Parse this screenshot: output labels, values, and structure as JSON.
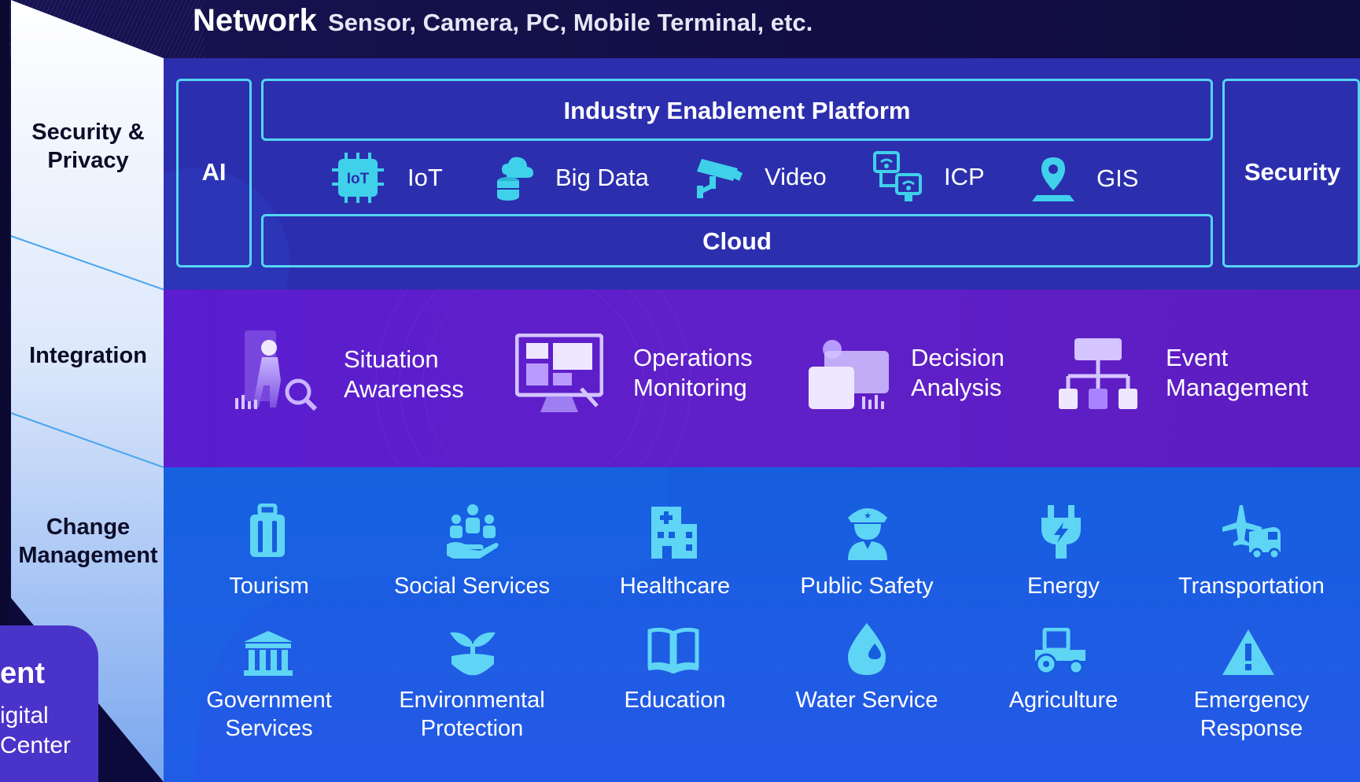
{
  "header": {
    "title": "Network",
    "subtitle": "Sensor, Camera, PC, Mobile Terminal, etc."
  },
  "left_labels": [
    "Security & Privacy",
    "Integration",
    "Change Management"
  ],
  "bottom_left": {
    "title": "ent",
    "line1": "igital",
    "line2": "Center"
  },
  "platform": {
    "ai": "AI",
    "title": "Industry Enablement Platform",
    "cloud": "Cloud",
    "security": "Security",
    "items": [
      {
        "label": "IoT",
        "icon": "iot-chip-icon",
        "icon_text": "IoT"
      },
      {
        "label": "Big Data",
        "icon": "cloud-database-icon"
      },
      {
        "label": "Video",
        "icon": "cctv-camera-icon"
      },
      {
        "label": "ICP",
        "icon": "wifi-devices-icon"
      },
      {
        "label": "GIS",
        "icon": "map-pin-icon"
      }
    ]
  },
  "integration": [
    {
      "line1": "Situation",
      "line2": "Awareness",
      "icon": "person-radar-icon"
    },
    {
      "line1": "Operations",
      "line2": "Monitoring",
      "icon": "monitor-dashboard-icon"
    },
    {
      "line1": "Decision",
      "line2": "Analysis",
      "icon": "decision-chart-icon"
    },
    {
      "line1": "Event",
      "line2": "Management",
      "icon": "hierarchy-icon"
    }
  ],
  "services_row1": [
    {
      "label": "Tourism",
      "icon": "luggage-icon"
    },
    {
      "label": "Social Services",
      "icon": "people-hand-icon"
    },
    {
      "label": "Healthcare",
      "icon": "hospital-icon"
    },
    {
      "label": "Public Safety",
      "icon": "police-officer-icon"
    },
    {
      "label": "Energy",
      "icon": "plug-icon"
    },
    {
      "label": "Transportation",
      "icon": "plane-truck-icon"
    }
  ],
  "services_row2": [
    {
      "line1": "Government",
      "line2": "Services",
      "icon": "government-building-icon"
    },
    {
      "line1": "Environmental",
      "line2": "Protection",
      "icon": "plant-icon"
    },
    {
      "line1": "Education",
      "line2": "",
      "icon": "book-icon"
    },
    {
      "line1": "Water Service",
      "line2": "",
      "icon": "water-drop-icon"
    },
    {
      "line1": "Agriculture",
      "line2": "",
      "icon": "tractor-icon"
    },
    {
      "line1": "Emergency",
      "line2": "Response",
      "icon": "warning-icon"
    }
  ],
  "colors": {
    "accent": "#53d6f4",
    "band_platform": "#2c2fad",
    "band_integration": "#5a1dcf",
    "band_services": "#155ede"
  }
}
